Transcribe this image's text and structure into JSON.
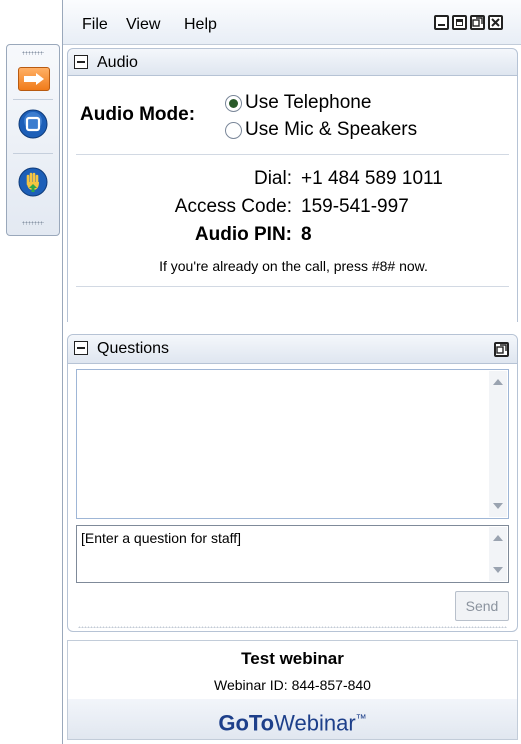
{
  "grab_tab": {
    "icons": [
      "arrow-right-icon",
      "screen-share-icon",
      "raise-hand-icon"
    ]
  },
  "menu": {
    "file": "File",
    "view": "View",
    "help": "Help"
  },
  "window_buttons": [
    "minimize-icon",
    "maximize-icon",
    "restore-icon",
    "close-icon"
  ],
  "audio": {
    "header": "Audio",
    "mode_label": "Audio Mode:",
    "options": [
      "Use Telephone",
      "Use Mic & Speakers"
    ],
    "selected": "Use Telephone",
    "dial_label": "Dial:",
    "dial_value": "+1 484 589 1011",
    "access_label": "Access Code:",
    "access_value": "159-541-997",
    "pin_label": "Audio PIN:",
    "pin_value": "8",
    "note": "If you're already on the call, press #8# now."
  },
  "questions": {
    "header": "Questions",
    "input_value": "[Enter a question for staff]",
    "send_label": "Send"
  },
  "footer": {
    "title": "Test webinar",
    "webinar_id": "Webinar ID: 844-857-840",
    "brand_goto": "GoTo",
    "brand_webinar": "Webinar",
    "brand_tm": "™"
  },
  "colors": {
    "accent_orange": "#f07b1a",
    "accent_blue": "#1d5fb8",
    "brand_blue": "#1d3f8a"
  }
}
